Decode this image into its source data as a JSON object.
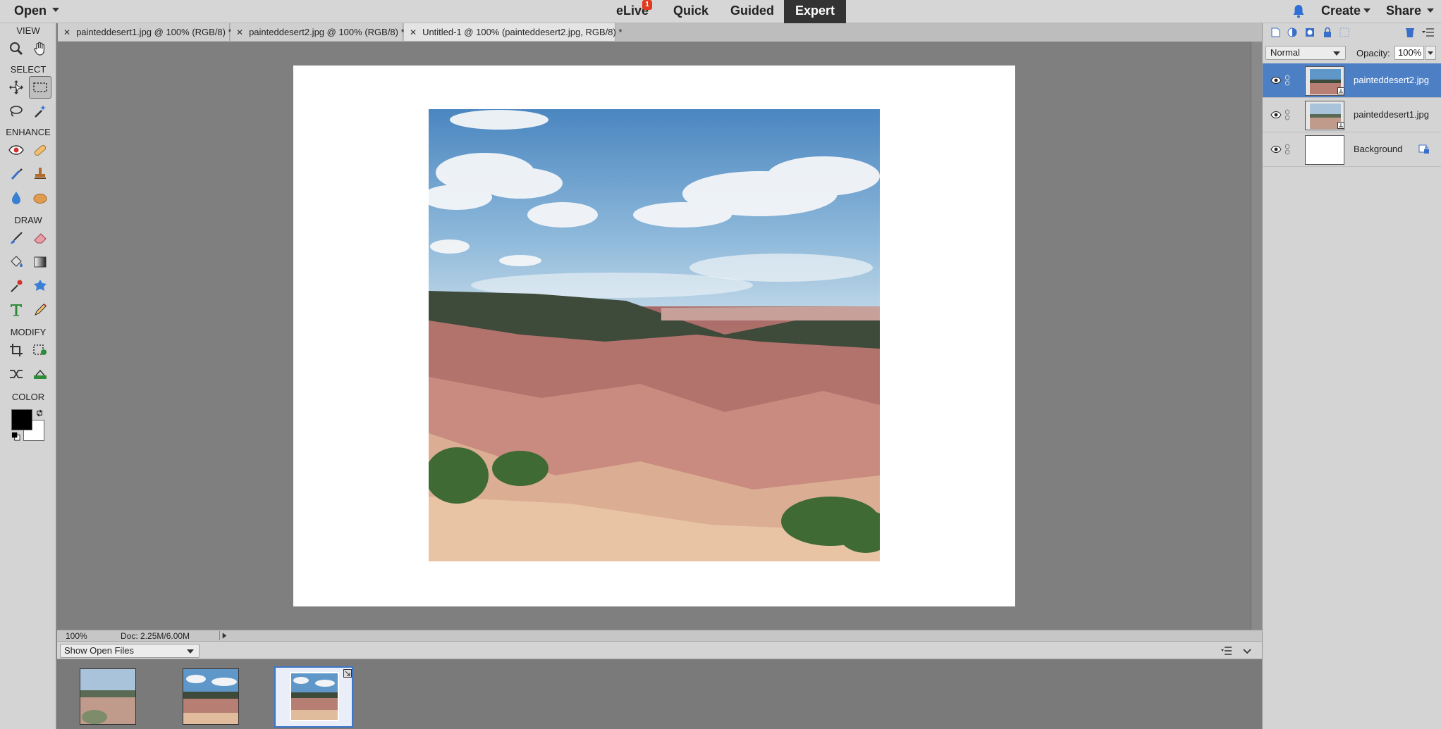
{
  "topbar": {
    "open_label": "Open",
    "modes": {
      "elive": "eLive",
      "elive_badge": "1",
      "quick": "Quick",
      "guided": "Guided",
      "expert": "Expert"
    },
    "create_label": "Create",
    "share_label": "Share"
  },
  "tabs": [
    {
      "label": "painteddesert1.jpg @ 100% (RGB/8) *",
      "active": false
    },
    {
      "label": "painteddesert2.jpg @ 100% (RGB/8) *",
      "active": false
    },
    {
      "label": "Untitled-1 @ 100% (painteddesert2.jpg, RGB/8) *",
      "active": true
    }
  ],
  "toolbox": {
    "sections": {
      "view": "VIEW",
      "select": "SELECT",
      "enhance": "ENHANCE",
      "draw": "DRAW",
      "modify": "MODIFY",
      "color": "COLOR"
    },
    "foreground_color": "#000000",
    "background_color": "#ffffff"
  },
  "status": {
    "zoom": "100%",
    "doc": "Doc: 2.25M/6.00M"
  },
  "bin": {
    "select_value": "Show Open Files"
  },
  "layers": {
    "blend_mode": "Normal",
    "opacity_label": "Opacity:",
    "opacity_value": "100%",
    "items": [
      {
        "name": "painteddesert2.jpg",
        "selected": true
      },
      {
        "name": "painteddesert1.jpg",
        "selected": false
      },
      {
        "name": "Background",
        "selected": false
      }
    ]
  },
  "colors": {
    "accent_selected": "#4d7fc4",
    "expert_active": "#333333",
    "badge": "#e03a1f"
  }
}
